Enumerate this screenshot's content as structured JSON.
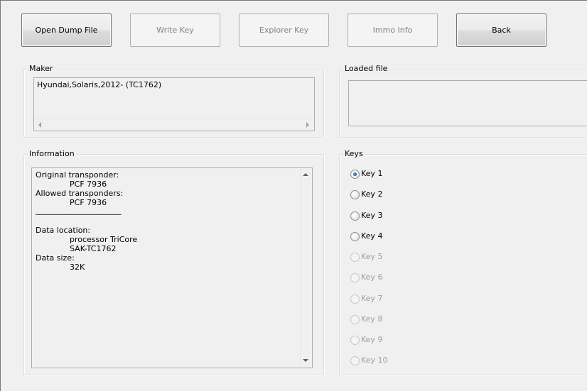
{
  "toolbar": {
    "open_dump_file": "Open Dump File",
    "write_key": "Write Key",
    "explorer_key": "Explorer Key",
    "immo_info": "Immo Info",
    "back": "Back"
  },
  "maker": {
    "label": "Maker",
    "value": "Hyundai,Solaris,2012- (TC1762)"
  },
  "loaded_file": {
    "label": "Loaded file",
    "value": ""
  },
  "information": {
    "label": "Information",
    "original_transponder_label": "Original transponder:",
    "original_transponder_value": "PCF 7936",
    "allowed_transponders_label": "Allowed transponders:",
    "allowed_transponders_value": "PCF 7936",
    "separator": "________________________",
    "data_location_label": "Data location:",
    "data_location_value_1": "processor TriCore",
    "data_location_value_2": "SAK-TC1762",
    "data_size_label": "Data size:",
    "data_size_value": "32K"
  },
  "keys": {
    "label": "Keys",
    "items": [
      {
        "label": "Key 1",
        "selected": true,
        "enabled": true
      },
      {
        "label": "Key 2",
        "selected": false,
        "enabled": true
      },
      {
        "label": "Key 3",
        "selected": false,
        "enabled": true
      },
      {
        "label": "Key 4",
        "selected": false,
        "enabled": true
      },
      {
        "label": "Key 5",
        "selected": false,
        "enabled": false
      },
      {
        "label": "Key 6",
        "selected": false,
        "enabled": false
      },
      {
        "label": "Key 7",
        "selected": false,
        "enabled": false
      },
      {
        "label": "Key 8",
        "selected": false,
        "enabled": false
      },
      {
        "label": "Key 9",
        "selected": false,
        "enabled": false
      },
      {
        "label": "Key 10",
        "selected": false,
        "enabled": false
      }
    ]
  }
}
